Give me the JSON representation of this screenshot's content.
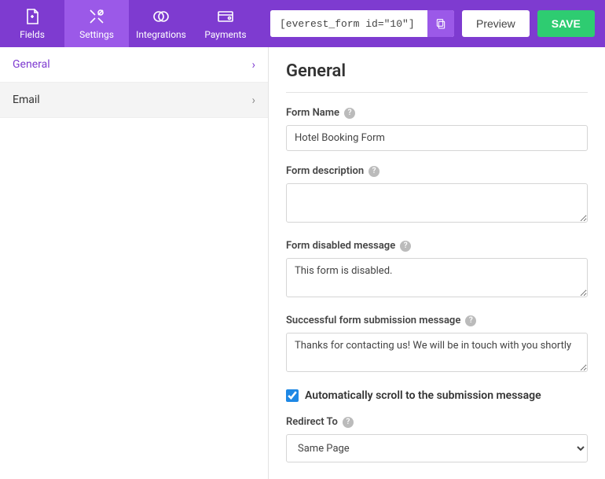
{
  "topbar": {
    "tabs": [
      {
        "label": "Fields"
      },
      {
        "label": "Settings"
      },
      {
        "label": "Integrations"
      },
      {
        "label": "Payments"
      }
    ],
    "shortcode": "[everest_form id=\"10\"]",
    "preview_label": "Preview",
    "save_label": "SAVE"
  },
  "sidebar": {
    "items": [
      {
        "label": "General"
      },
      {
        "label": "Email"
      }
    ]
  },
  "content": {
    "title": "General",
    "form_name": {
      "label": "Form Name",
      "value": "Hotel Booking Form"
    },
    "form_description": {
      "label": "Form description",
      "value": ""
    },
    "disabled_message": {
      "label": "Form disabled message",
      "value": "This form is disabled."
    },
    "success_message": {
      "label": "Successful form submission message",
      "value": "Thanks for contacting us! We will be in touch with you shortly"
    },
    "auto_scroll": {
      "label": "Automatically scroll to the submission message",
      "checked": true
    },
    "redirect_to": {
      "label": "Redirect To",
      "value": "Same Page"
    }
  }
}
